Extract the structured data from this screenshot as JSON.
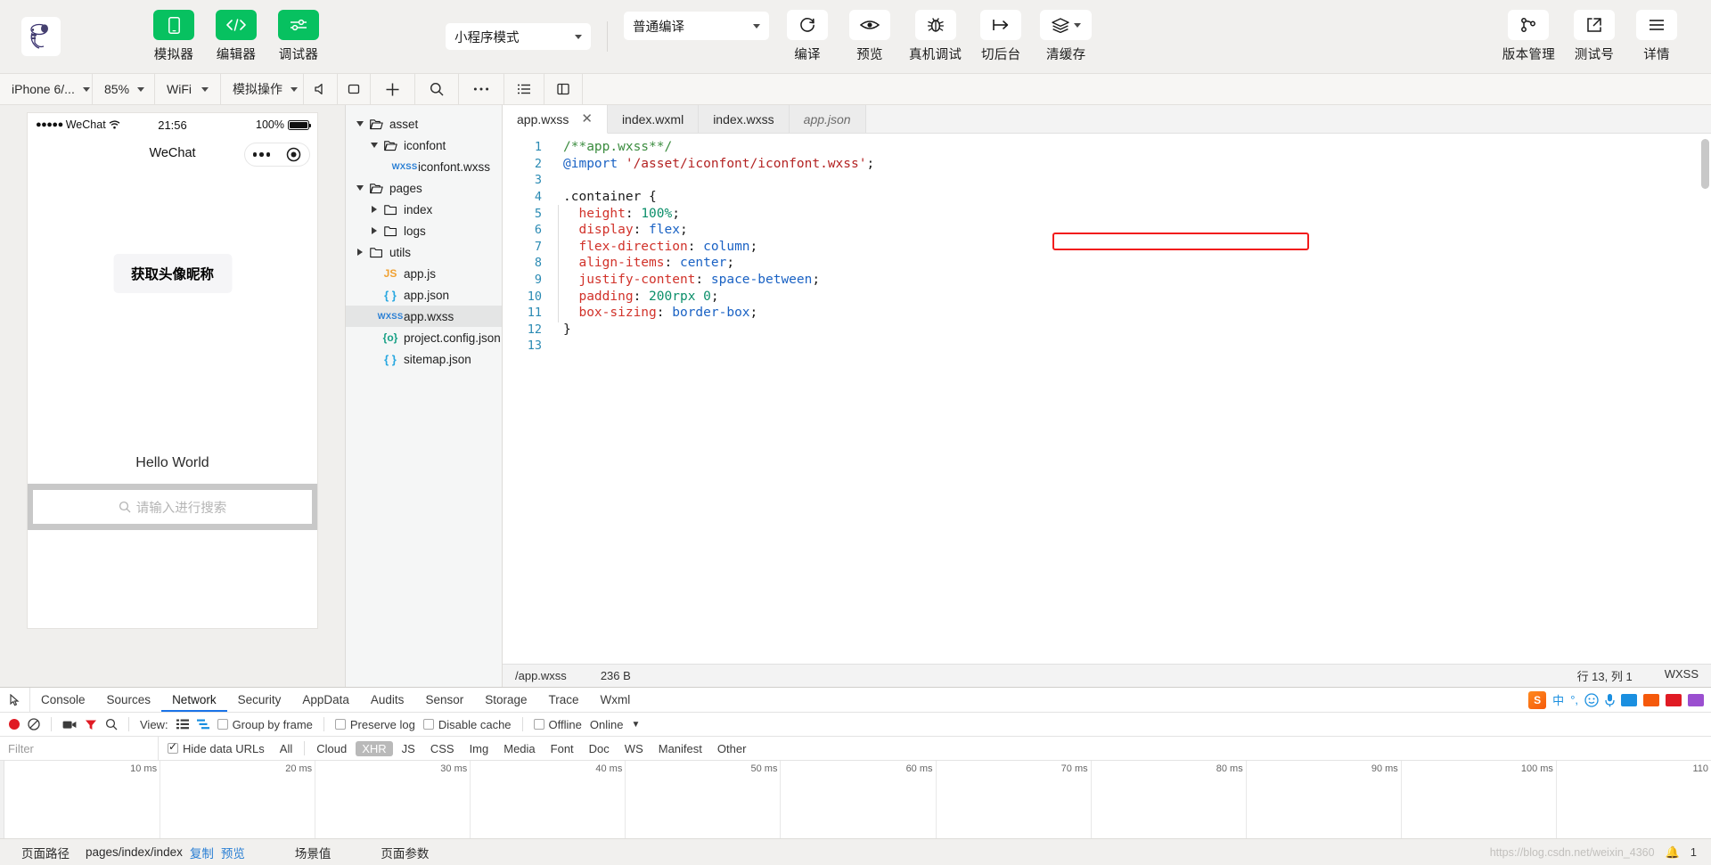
{
  "toolbar": {
    "logo_alt": "snoopy-logo",
    "buttons": [
      {
        "icon": "phone-icon",
        "label": "模拟器"
      },
      {
        "icon": "code-icon",
        "label": "编辑器"
      },
      {
        "icon": "sliders-icon",
        "label": "调试器"
      }
    ],
    "mode_select": {
      "value": "小程序模式"
    },
    "compile_select": {
      "value": "普通编译"
    },
    "actions": [
      {
        "icon": "refresh-icon",
        "label": "编译"
      },
      {
        "icon": "eye-icon",
        "label": "预览"
      },
      {
        "icon": "bug-icon",
        "label": "真机调试"
      },
      {
        "icon": "background-icon",
        "label": "切后台"
      },
      {
        "icon": "layers-icon",
        "label": "清缓存"
      }
    ],
    "right_actions": [
      {
        "icon": "branch-icon",
        "label": "版本管理"
      },
      {
        "icon": "external-link-icon",
        "label": "测试号"
      },
      {
        "icon": "menu-icon",
        "label": "详情"
      }
    ]
  },
  "secondbar": {
    "device": "iPhone 6/...",
    "zoom": "85%",
    "network": "WiFi",
    "simulate": "模拟操作",
    "icons": [
      "volume-icon",
      "rotate-icon",
      "plus-icon",
      "search-icon",
      "more-icon",
      "outline-icon",
      "panel-icon"
    ]
  },
  "simulator": {
    "status": {
      "carrier_dots": "●●●●●",
      "carrier": "WeChat",
      "wifi": "wifi-icon",
      "time": "21:56",
      "battery_pct": "100%"
    },
    "nav_title": "WeChat",
    "avatar_button": "获取头像昵称",
    "hello_text": "Hello World",
    "search_placeholder": "请输入进行搜索",
    "search_icon": "search-icon"
  },
  "filetree": [
    {
      "label": "asset",
      "type": "folder",
      "depth": 0,
      "open": true,
      "selected": false
    },
    {
      "label": "iconfont",
      "type": "folder",
      "depth": 1,
      "open": true,
      "selected": false
    },
    {
      "label": "iconfont.wxss",
      "type": "wxss",
      "depth": 2,
      "open": null,
      "selected": false
    },
    {
      "label": "pages",
      "type": "folder",
      "depth": 0,
      "open": true,
      "selected": false
    },
    {
      "label": "index",
      "type": "folder",
      "depth": 1,
      "open": false,
      "selected": false
    },
    {
      "label": "logs",
      "type": "folder",
      "depth": 1,
      "open": false,
      "selected": false
    },
    {
      "label": "utils",
      "type": "folder",
      "depth": 0,
      "open": false,
      "selected": false
    },
    {
      "label": "app.js",
      "type": "js",
      "depth": 1,
      "open": null,
      "selected": false
    },
    {
      "label": "app.json",
      "type": "json",
      "depth": 1,
      "open": null,
      "selected": false
    },
    {
      "label": "app.wxss",
      "type": "wxss",
      "depth": 1,
      "open": null,
      "selected": true
    },
    {
      "label": "project.config.json",
      "type": "cfg",
      "depth": 1,
      "open": null,
      "selected": false
    },
    {
      "label": "sitemap.json",
      "type": "json",
      "depth": 1,
      "open": null,
      "selected": false
    }
  ],
  "editor": {
    "tabs": [
      {
        "label": "app.wxss",
        "active": true,
        "closable": true,
        "preview": false
      },
      {
        "label": "index.wxml",
        "active": false,
        "closable": false,
        "preview": false
      },
      {
        "label": "index.wxss",
        "active": false,
        "closable": false,
        "preview": false
      },
      {
        "label": "app.json",
        "active": false,
        "closable": false,
        "preview": true
      }
    ],
    "close_glyph": "✕",
    "lines": [
      {
        "n": "1",
        "tokens": [
          {
            "t": "/**app.wxss**/",
            "c": "k-comment"
          }
        ]
      },
      {
        "n": "2",
        "tokens": [
          {
            "t": "@import",
            "c": "k-at"
          },
          {
            "t": " ",
            "c": "k-punc"
          },
          {
            "t": "'/asset/iconfont/iconfont.wxss'",
            "c": "k-str"
          },
          {
            "t": ";",
            "c": "k-punc"
          }
        ]
      },
      {
        "n": "3",
        "tokens": []
      },
      {
        "n": "4",
        "tokens": [
          {
            "t": ".container {",
            "c": "k-sel"
          }
        ]
      },
      {
        "n": "5",
        "tokens": [
          {
            "t": "  height",
            "c": "k-prop"
          },
          {
            "t": ": ",
            "c": "k-punc"
          },
          {
            "t": "100%",
            "c": "k-num"
          },
          {
            "t": ";",
            "c": "k-punc"
          }
        ]
      },
      {
        "n": "6",
        "tokens": [
          {
            "t": "  display",
            "c": "k-prop"
          },
          {
            "t": ": ",
            "c": "k-punc"
          },
          {
            "t": "flex",
            "c": "k-val"
          },
          {
            "t": ";",
            "c": "k-punc"
          }
        ]
      },
      {
        "n": "7",
        "tokens": [
          {
            "t": "  flex-direction",
            "c": "k-prop"
          },
          {
            "t": ": ",
            "c": "k-punc"
          },
          {
            "t": "column",
            "c": "k-val"
          },
          {
            "t": ";",
            "c": "k-punc"
          }
        ]
      },
      {
        "n": "8",
        "tokens": [
          {
            "t": "  align-items",
            "c": "k-prop"
          },
          {
            "t": ": ",
            "c": "k-punc"
          },
          {
            "t": "center",
            "c": "k-val"
          },
          {
            "t": ";",
            "c": "k-punc"
          }
        ]
      },
      {
        "n": "9",
        "tokens": [
          {
            "t": "  justify-content",
            "c": "k-prop"
          },
          {
            "t": ": ",
            "c": "k-punc"
          },
          {
            "t": "space-between",
            "c": "k-val"
          },
          {
            "t": ";",
            "c": "k-punc"
          }
        ]
      },
      {
        "n": "10",
        "tokens": [
          {
            "t": "  padding",
            "c": "k-prop"
          },
          {
            "t": ": ",
            "c": "k-punc"
          },
          {
            "t": "200rpx 0",
            "c": "k-num"
          },
          {
            "t": ";",
            "c": "k-punc"
          }
        ]
      },
      {
        "n": "11",
        "tokens": [
          {
            "t": "  box-sizing",
            "c": "k-prop"
          },
          {
            "t": ": ",
            "c": "k-punc"
          },
          {
            "t": "border-box",
            "c": "k-val"
          },
          {
            "t": ";",
            "c": "k-punc"
          }
        ]
      },
      {
        "n": "12",
        "tokens": [
          {
            "t": "}",
            "c": "k-sel"
          }
        ]
      },
      {
        "n": "13",
        "tokens": []
      }
    ],
    "status": {
      "path": "/app.wxss",
      "size": "236 B",
      "cursor": "行 13, 列 1",
      "language": "WXSS"
    }
  },
  "devtools": {
    "picker_icon": "cursor-picker-icon",
    "tabs": [
      {
        "label": "Console",
        "active": false
      },
      {
        "label": "Sources",
        "active": false
      },
      {
        "label": "Network",
        "active": true
      },
      {
        "label": "Security",
        "active": false
      },
      {
        "label": "AppData",
        "active": false
      },
      {
        "label": "Audits",
        "active": false
      },
      {
        "label": "Sensor",
        "active": false
      },
      {
        "label": "Storage",
        "active": false
      },
      {
        "label": "Trace",
        "active": false
      },
      {
        "label": "Wxml",
        "active": false
      }
    ],
    "controls": {
      "record_icon": "record-icon",
      "clear_icon": "clear-icon",
      "camera_icon": "camera-icon",
      "filter_icon": "filter-icon",
      "search_icon": "search-icon",
      "view_label": "View:",
      "view_list_icon": "list-view-icon",
      "view_waterfall_icon": "waterfall-view-icon",
      "group_by_frame": "Group by frame",
      "preserve_log": "Preserve log",
      "disable_cache": "Disable cache",
      "offline": "Offline",
      "online": "Online",
      "caret": "▼"
    },
    "filter": {
      "placeholder": "Filter",
      "hide_data_urls": "Hide data URLs",
      "hide_data_urls_checked": true,
      "types": [
        "All",
        "Cloud",
        "XHR",
        "JS",
        "CSS",
        "Img",
        "Media",
        "Font",
        "Doc",
        "WS",
        "Manifest",
        "Other"
      ],
      "active_type": "XHR"
    },
    "timeline_ticks": [
      "10 ms",
      "20 ms",
      "30 ms",
      "40 ms",
      "50 ms",
      "60 ms",
      "70 ms",
      "80 ms",
      "90 ms",
      "100 ms",
      "110"
    ]
  },
  "bottombar": {
    "page_path_label": "页面路径",
    "page_path_value": "pages/index/index",
    "copy": "复制",
    "preview": "预览",
    "scene_value": "场景值",
    "page_params": "页面参数",
    "watermark": "https://blog.csdn.net/weixin_4360",
    "bell_icon": "bell-icon",
    "bell_count": "1"
  },
  "colors": {
    "accent": "#07c160",
    "highlight": "#f21c1c",
    "link": "#2a7fd4",
    "devtools_active": "#1a73e8"
  }
}
